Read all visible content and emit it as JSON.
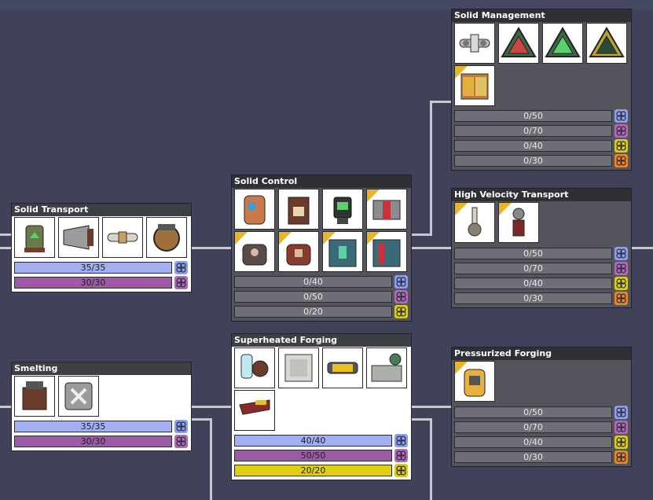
{
  "colors": {
    "background": "#3f4259",
    "wire": "#c8c9cf",
    "research_basic": "#a3aff0",
    "research_advanced": "#9e5aa6",
    "research_interstellar": "#e0cf14",
    "research_orbital": "#e88232",
    "icon_basic": "#8e9fe6",
    "icon_advanced": "#b06bb5",
    "icon_interstellar": "#d8cc20",
    "icon_orbital": "#e8872a",
    "new_ribbon": "#e8b42a"
  },
  "cards": [
    {
      "id": "solid-management",
      "title": "Solid Management",
      "status": "locked",
      "items": [
        {
          "icon": "conveyor-meter-icon",
          "new": false
        },
        {
          "icon": "rail-sensor-red-icon",
          "new": false
        },
        {
          "icon": "rail-sensor-green-icon",
          "new": false
        },
        {
          "icon": "rail-sensor-yellow-icon",
          "new": false
        },
        {
          "icon": "solid-storage-rack-icon",
          "new": true
        }
      ],
      "research": [
        {
          "type": "basic",
          "label": "0/50",
          "fraction": 0
        },
        {
          "type": "advanced",
          "label": "0/70",
          "fraction": 0
        },
        {
          "type": "interstellar",
          "label": "0/40",
          "fraction": 0
        },
        {
          "type": "orbital",
          "label": "0/30",
          "fraction": 0
        }
      ]
    },
    {
      "id": "solid-transport",
      "title": "Solid Transport",
      "status": "complete",
      "items": [
        {
          "icon": "conveyor-loader-icon",
          "new": false
        },
        {
          "icon": "conveyor-receptacle-icon",
          "new": false
        },
        {
          "icon": "conveyor-rail-icon",
          "new": false
        },
        {
          "icon": "auto-sweeper-icon",
          "new": false
        }
      ],
      "research": [
        {
          "type": "basic",
          "label": "35/35",
          "fraction": 1
        },
        {
          "type": "advanced",
          "label": "30/30",
          "fraction": 1
        }
      ]
    },
    {
      "id": "solid-control",
      "title": "Solid Control",
      "status": "locked",
      "items": [
        {
          "icon": "conveyor-chute-icon",
          "new": false
        },
        {
          "icon": "solid-filter-icon",
          "new": false
        },
        {
          "icon": "solid-sensor-icon",
          "new": false
        },
        {
          "icon": "conveyor-shutoff-icon",
          "new": true
        },
        {
          "icon": "solid-bridge-icon",
          "new": true
        },
        {
          "icon": "solid-meter-icon",
          "new": true
        },
        {
          "icon": "smart-storage-icon",
          "new": true
        },
        {
          "icon": "solid-locker-icon",
          "new": true
        }
      ],
      "research": [
        {
          "type": "basic",
          "label": "0/40",
          "fraction": 0
        },
        {
          "type": "advanced",
          "label": "0/50",
          "fraction": 0
        },
        {
          "type": "interstellar",
          "label": "0/20",
          "fraction": 0
        }
      ]
    },
    {
      "id": "high-velocity-transport",
      "title": "High Velocity Transport",
      "status": "locked",
      "items": [
        {
          "icon": "rail-launcher-icon",
          "new": true
        },
        {
          "icon": "rail-receptacle-icon",
          "new": true
        }
      ],
      "research": [
        {
          "type": "basic",
          "label": "0/50",
          "fraction": 0
        },
        {
          "type": "advanced",
          "label": "0/70",
          "fraction": 0
        },
        {
          "type": "interstellar",
          "label": "0/40",
          "fraction": 0
        },
        {
          "type": "orbital",
          "label": "0/30",
          "fraction": 0
        }
      ]
    },
    {
      "id": "smelting",
      "title": "Smelting",
      "status": "complete",
      "items": [
        {
          "icon": "metal-refinery-icon",
          "new": false
        },
        {
          "icon": "glass-forge-icon",
          "new": false
        }
      ],
      "research": [
        {
          "type": "basic",
          "label": "35/35",
          "fraction": 1
        },
        {
          "type": "advanced",
          "label": "30/30",
          "fraction": 1
        }
      ]
    },
    {
      "id": "superheated-forging",
      "title": "Superheated Forging",
      "status": "complete",
      "items": [
        {
          "icon": "kiln-glass-icon",
          "new": false
        },
        {
          "icon": "tile-block-icon",
          "new": false
        },
        {
          "icon": "hazard-rail-icon",
          "new": false
        },
        {
          "icon": "workbench-icon",
          "new": false
        },
        {
          "icon": "heavy-wire-icon",
          "new": false
        }
      ],
      "research": [
        {
          "type": "basic",
          "label": "40/40",
          "fraction": 1
        },
        {
          "type": "advanced",
          "label": "50/50",
          "fraction": 1
        },
        {
          "type": "interstellar",
          "label": "20/20",
          "fraction": 1
        }
      ]
    },
    {
      "id": "pressurized-forging",
      "title": "Pressurized Forging",
      "status": "locked",
      "items": [
        {
          "icon": "diamond-press-icon",
          "new": true
        }
      ],
      "research": [
        {
          "type": "basic",
          "label": "0/50",
          "fraction": 0
        },
        {
          "type": "advanced",
          "label": "0/70",
          "fraction": 0
        },
        {
          "type": "interstellar",
          "label": "0/40",
          "fraction": 0
        },
        {
          "type": "orbital",
          "label": "0/30",
          "fraction": 0
        }
      ]
    }
  ]
}
